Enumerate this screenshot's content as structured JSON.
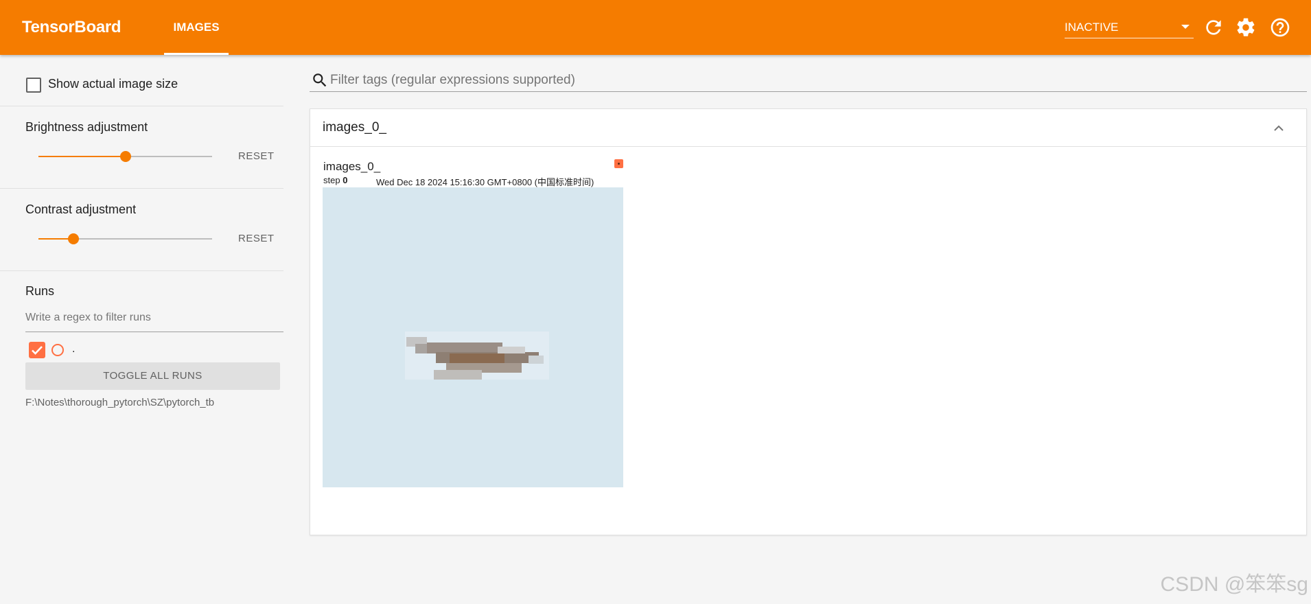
{
  "header": {
    "brand": "TensorBoard",
    "tab_images": "IMAGES",
    "status_value": "INACTIVE",
    "icons": [
      "refresh-icon",
      "settings-icon",
      "help-icon"
    ],
    "accent_color": "#f57c00"
  },
  "sidebar": {
    "show_actual_size_label": "Show actual image size",
    "brightness": {
      "label": "Brightness adjustment",
      "value": 0.5,
      "reset": "RESET"
    },
    "contrast": {
      "label": "Contrast adjustment",
      "value": 0.2,
      "reset": "RESET"
    },
    "runs": {
      "label": "Runs",
      "filter_placeholder": "Write a regex to filter runs",
      "run_name": ".",
      "toggle_all": "TOGGLE ALL RUNS",
      "logdir": "F:\\Notes\\thorough_pytorch\\SZ\\pytorch_tb",
      "run_color": "#ff7043"
    }
  },
  "main": {
    "filter_placeholder": "Filter tags (regular expressions supported)",
    "card": {
      "title": "images_0_",
      "image": {
        "title": "images_0_",
        "step_label": "step",
        "step_value": "0",
        "timestamp": "Wed Dec 18 2024 15:16:30 GMT+0800 (中国标准时间)"
      }
    }
  },
  "watermark": "CSDN @笨笨sg"
}
